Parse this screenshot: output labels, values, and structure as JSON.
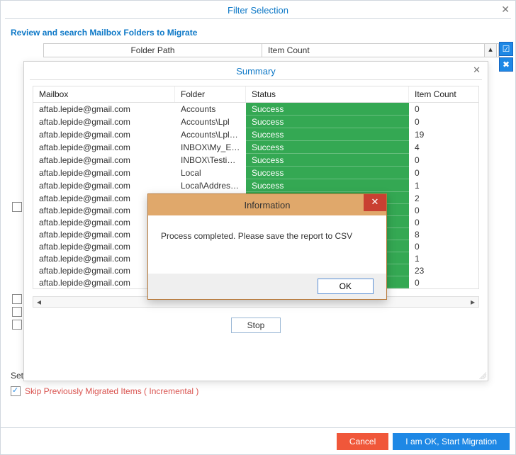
{
  "outer": {
    "title": "Filter Selection",
    "review": "Review and search Mailbox Folders to Migrate",
    "col_folder_path": "Folder Path",
    "col_item_count": "Item Count",
    "settings_label": "Set",
    "skip_label": "Skip Previously Migrated Items ( Incremental )"
  },
  "footer": {
    "cancel": "Cancel",
    "ok": "I am OK, Start Migration"
  },
  "summary": {
    "title": "Summary",
    "headers": {
      "mailbox": "Mailbox",
      "folder": "Folder",
      "status": "Status",
      "item_count": "Item Count"
    },
    "stop": "Stop",
    "rows": [
      {
        "mailbox": "aftab.lepide@gmail.com",
        "folder": "Accounts",
        "status": "Success",
        "item_count": "0"
      },
      {
        "mailbox": "aftab.lepide@gmail.com",
        "folder": "Accounts\\Lpl",
        "status": "Success",
        "item_count": "0"
      },
      {
        "mailbox": "aftab.lepide@gmail.com",
        "folder": "Accounts\\Lpl\\N...",
        "status": "Success",
        "item_count": "19"
      },
      {
        "mailbox": "aftab.lepide@gmail.com",
        "folder": "INBOX\\My_Emails",
        "status": "Success",
        "item_count": "4"
      },
      {
        "mailbox": "aftab.lepide@gmail.com",
        "folder": "INBOX\\Testing M",
        "status": "Success",
        "item_count": "0"
      },
      {
        "mailbox": "aftab.lepide@gmail.com",
        "folder": "Local",
        "status": "Success",
        "item_count": "0"
      },
      {
        "mailbox": "aftab.lepide@gmail.com",
        "folder": "Local\\Address B",
        "status": "Success",
        "item_count": "1"
      },
      {
        "mailbox": "aftab.lepide@gmail.com",
        "folder": "",
        "status": "",
        "item_count": "2"
      },
      {
        "mailbox": "aftab.lepide@gmail.com",
        "folder": "",
        "status": "",
        "item_count": "0"
      },
      {
        "mailbox": "aftab.lepide@gmail.com",
        "folder": "",
        "status": "",
        "item_count": "0"
      },
      {
        "mailbox": "aftab.lepide@gmail.com",
        "folder": "",
        "status": "",
        "item_count": "8"
      },
      {
        "mailbox": "aftab.lepide@gmail.com",
        "folder": "",
        "status": "",
        "item_count": "0"
      },
      {
        "mailbox": "aftab.lepide@gmail.com",
        "folder": "",
        "status": "",
        "item_count": "1"
      },
      {
        "mailbox": "aftab.lepide@gmail.com",
        "folder": "",
        "status": "",
        "item_count": "23"
      },
      {
        "mailbox": "aftab.lepide@gmail.com",
        "folder": "",
        "status": "",
        "item_count": "0"
      }
    ]
  },
  "info": {
    "title": "Information",
    "message": "Process completed. Please save the report to CSV",
    "ok": "OK"
  }
}
